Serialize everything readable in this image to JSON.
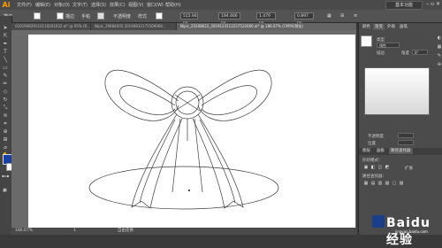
{
  "app": {
    "logo": "Ai"
  },
  "menubar": {
    "items": [
      "文件(F)",
      "编辑(E)",
      "对象(O)",
      "文字(T)",
      "选择(S)",
      "效果(C)",
      "视图(V)",
      "窗口(W)",
      "帮助(H)"
    ],
    "workspace": "基本功能",
    "window_controls": "– ▫ ✕"
  },
  "controlbar": {
    "left_label": "描边",
    "stroke_label": "描边",
    "brush_label": "手帕",
    "opacity_label": "不透明度",
    "style_label": "样式",
    "x_value": "515.94 px",
    "y_value": "194.466 px",
    "w_value": "1.479 px",
    "h_value": "0.897 px"
  },
  "doc_tabs": [
    {
      "label": "020190829110110201032.ai* @ 95% (R...",
      "active": false
    },
    {
      "label": "Nipic_29684005 20190812175509068...",
      "active": false
    },
    {
      "label": "Nipic_25268622_2019123112237522000.ai* @ 186.67% (CMYK/预览)",
      "active": true
    }
  ],
  "statusbar": {
    "zoom": "186.67%",
    "page": "1",
    "tool": "自由变换"
  },
  "rightpanel": {
    "tabs": [
      "颜色",
      "渐变",
      "外观",
      "画笔"
    ],
    "type_label": "类型",
    "type_value": "线性",
    "stroke_label": "描边",
    "angle_label": "角度",
    "angle_value": "0°",
    "opacity_label": "不透明度",
    "position_label": "位置",
    "layers_tabs": [
      "图层",
      "画板",
      "路径查找器"
    ],
    "shape_mode_label": "形状模式：",
    "pathfinder_label": "路径查找器：",
    "expand_label": "扩展"
  },
  "watermark": {
    "text": "Baidu 经验",
    "url": "jingyan.baidu.com"
  },
  "colors": {
    "fill": "#1a3fa0",
    "stroke": "#ffffff",
    "accent": "#ff9a00"
  }
}
